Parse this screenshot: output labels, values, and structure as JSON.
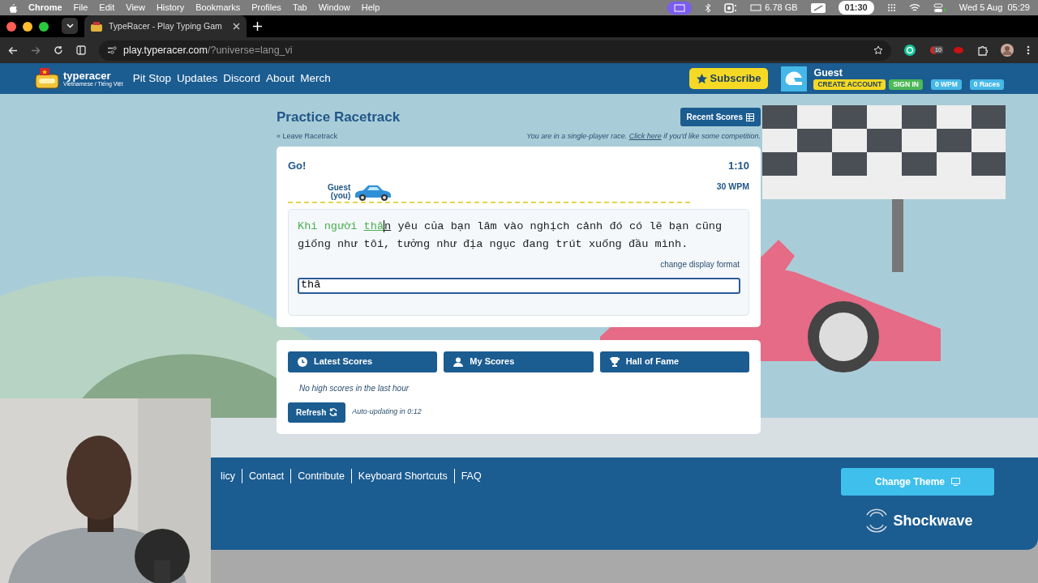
{
  "menubar": {
    "app": "Chrome",
    "items": [
      "File",
      "Edit",
      "View",
      "History",
      "Bookmarks",
      "Profiles",
      "Tab",
      "Window",
      "Help"
    ],
    "memory": "6.78 GB",
    "timer": "01:30",
    "datetime": "Wed 5 Aug  05:29"
  },
  "browser": {
    "tab_title": "TypeRacer - Play Typing Gam",
    "url_host": "play.typeracer.com",
    "url_path": "/?universe=lang_vi",
    "extension_badge": "10"
  },
  "site_nav": {
    "logo_text": "typeracer",
    "logo_sub": "Vietnamese / Tiếng Việt",
    "links": [
      "Pit Stop",
      "Updates",
      "Discord",
      "About",
      "Merch"
    ],
    "subscribe": "Subscribe",
    "user": "Guest",
    "create_account": "CREATE ACCOUNT",
    "sign_in": "SIGN IN",
    "wpm": "0 WPM",
    "races": "0 Races"
  },
  "race": {
    "title": "Practice Racetrack",
    "recent_scores": "Recent Scores",
    "leave": "« Leave Racetrack",
    "notice_before": "You are in a single-player race.",
    "notice_link": "Click here",
    "notice_after": "if you'd like some competition.",
    "status": "Go!",
    "timer": "1:10",
    "racer_name": "Guest",
    "racer_note": "(you)",
    "progress": {
      "level": 0.26
    },
    "wpm": "30 WPM",
    "passage": {
      "typed": "Khi người",
      "current_typed": "thâ",
      "current_rest": "n",
      "remaining": "yêu của bạn lâm vào nghịch cảnh đó có lẽ bạn cũng giống như tôi, tưởng như địa ngục đang trút xuống đầu mình."
    },
    "change_format": "change display format",
    "input_value": "thâ"
  },
  "scores": {
    "tabs": [
      "Latest Scores",
      "My Scores",
      "Hall of Fame"
    ],
    "empty": "No high scores in the last hour",
    "refresh": "Refresh",
    "auto_update": "Auto-updating in 0:12"
  },
  "footer": {
    "links": [
      "licy",
      "Contact",
      "Contribute",
      "Keyboard Shortcuts",
      "FAQ"
    ],
    "change_theme": "Change Theme",
    "brand": "Shockwave"
  }
}
